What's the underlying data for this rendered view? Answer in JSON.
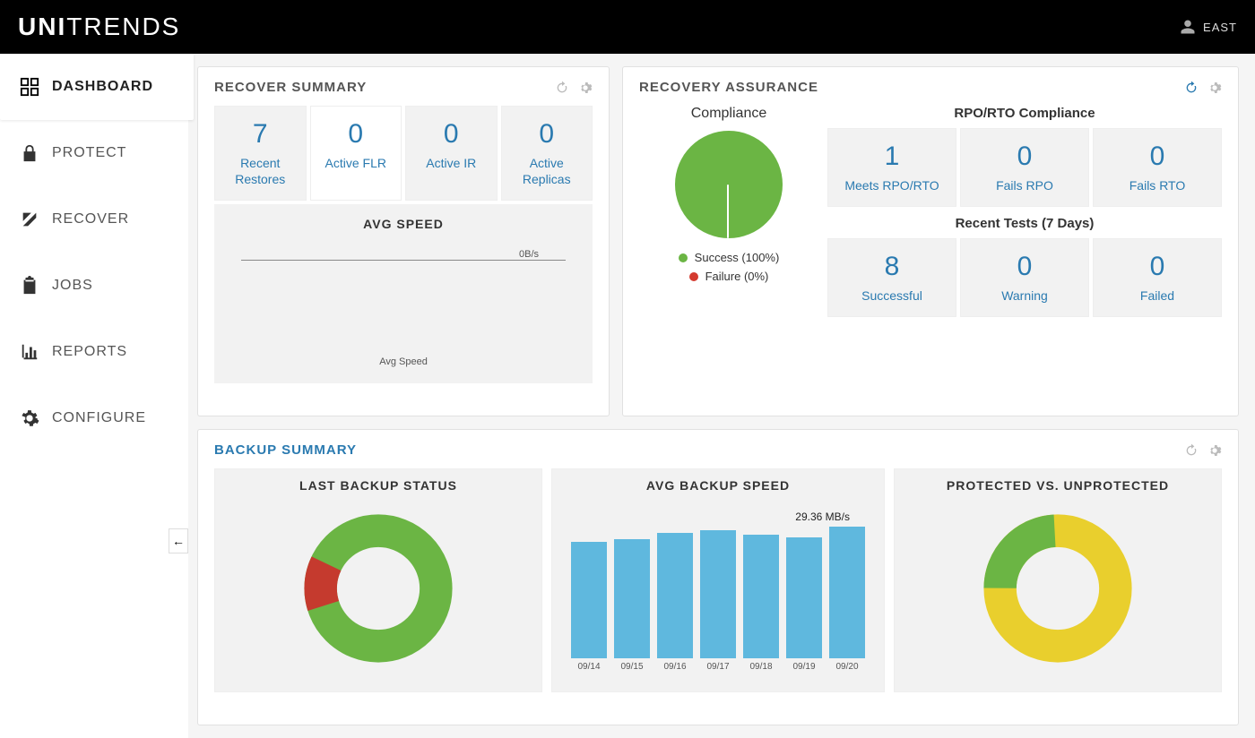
{
  "brand": {
    "strong": "UNI",
    "light": "TRENDS"
  },
  "user": {
    "name": "EAST"
  },
  "sidebar": {
    "items": [
      {
        "label": "DASHBOARD",
        "icon": "grid",
        "active": true
      },
      {
        "label": "PROTECT",
        "icon": "lock",
        "active": false
      },
      {
        "label": "RECOVER",
        "icon": "arrow-up-left",
        "active": false
      },
      {
        "label": "JOBS",
        "icon": "clipboard",
        "active": false
      },
      {
        "label": "REPORTS",
        "icon": "bar-chart",
        "active": false
      },
      {
        "label": "CONFIGURE",
        "icon": "gear",
        "active": false
      }
    ],
    "collapse": "←"
  },
  "recover_summary": {
    "title": "RECOVER SUMMARY",
    "stats": [
      {
        "value": "7",
        "label": "Recent Restores"
      },
      {
        "value": "0",
        "label": "Active FLR"
      },
      {
        "value": "0",
        "label": "Active IR"
      },
      {
        "value": "0",
        "label": "Active Replicas"
      }
    ],
    "avg_speed": {
      "title": "AVG SPEED",
      "value": "0B/s",
      "caption": "Avg Speed"
    }
  },
  "recovery_assurance": {
    "title": "RECOVERY ASSURANCE",
    "compliance": {
      "title": "Compliance",
      "legend": [
        {
          "label": "Success (100%)",
          "color": "green"
        },
        {
          "label": "Failure (0%)",
          "color": "red"
        }
      ]
    },
    "rpo": {
      "title": "RPO/RTO Compliance",
      "stats": [
        {
          "value": "1",
          "label": "Meets RPO/RTO"
        },
        {
          "value": "0",
          "label": "Fails RPO"
        },
        {
          "value": "0",
          "label": "Fails RTO"
        }
      ]
    },
    "recent": {
      "title": "Recent Tests (7 Days)",
      "stats": [
        {
          "value": "8",
          "label": "Successful"
        },
        {
          "value": "0",
          "label": "Warning"
        },
        {
          "value": "0",
          "label": "Failed"
        }
      ]
    }
  },
  "backup_summary": {
    "title": "BACKUP SUMMARY",
    "last_status": {
      "title": "LAST BACKUP STATUS"
    },
    "avg_speed": {
      "title": "AVG BACKUP SPEED",
      "peak_label": "29.36 MB/s"
    },
    "protected": {
      "title": "PROTECTED VS. UNPROTECTED"
    }
  },
  "chart_data": [
    {
      "type": "pie",
      "title": "Compliance",
      "series": [
        {
          "name": "Success",
          "values": [
            100
          ],
          "color": "#6bb544"
        },
        {
          "name": "Failure",
          "values": [
            0
          ],
          "color": "#d43a2f"
        }
      ]
    },
    {
      "type": "pie",
      "title": "Last Backup Status",
      "series": [
        {
          "name": "Success",
          "values": [
            88
          ],
          "color": "#6bb544"
        },
        {
          "name": "Failure",
          "values": [
            12
          ],
          "color": "#c53a2e"
        }
      ],
      "donut": true
    },
    {
      "type": "bar",
      "title": "Avg Backup Speed",
      "categories": [
        "09/14",
        "09/15",
        "09/16",
        "09/17",
        "09/18",
        "09/19",
        "09/20"
      ],
      "values": [
        26,
        26.5,
        28,
        28.5,
        27.5,
        27,
        29.36
      ],
      "ylabel": "MB/s",
      "ylim": [
        0,
        30
      ]
    },
    {
      "type": "pie",
      "title": "Protected vs. Unprotected",
      "series": [
        {
          "name": "Protected",
          "values": [
            24
          ],
          "color": "#6bb544"
        },
        {
          "name": "Unprotected",
          "values": [
            76
          ],
          "color": "#e9cf2d"
        }
      ],
      "donut": true
    }
  ],
  "colors": {
    "accent": "#2a7ab0",
    "green": "#6bb544",
    "red": "#d43a2f",
    "yellow": "#e9cf2d",
    "blue_bar": "#5fb8de"
  }
}
